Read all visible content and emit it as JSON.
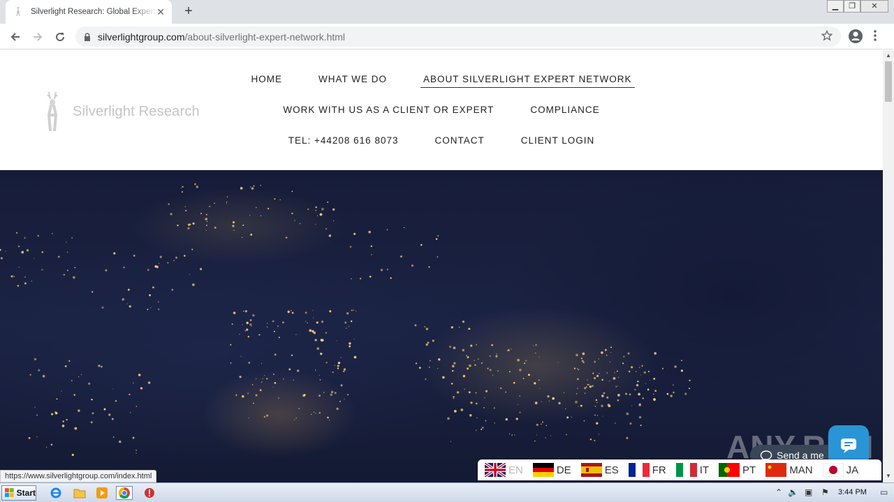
{
  "browser": {
    "tab_title": "Silverlight Research: Global Expert N",
    "tab_close": "✕",
    "new_tab": "+",
    "url_domain": "silverlightgroup.com",
    "url_path": "/about-silverlight-expert-network.html",
    "window_controls": [
      "▁",
      "❐",
      "✕"
    ]
  },
  "site": {
    "logo_text": "Silverlight Research",
    "nav": {
      "row1": [
        "HOME",
        "WHAT WE DO",
        "ABOUT SILVERLIGHT EXPERT NETWORK"
      ],
      "row2": [
        "WORK WITH US AS A CLIENT OR EXPERT",
        "COMPLIANCE"
      ],
      "row3": [
        "TEL: +44208 616 8073",
        "CONTACT",
        "CLIENT LOGIN"
      ],
      "active": "ABOUT SILVERLIGHT EXPERT NETWORK"
    },
    "languages": [
      "EN",
      "DE",
      "ES",
      "FR",
      "IT",
      "PT",
      "MAN",
      "JA"
    ],
    "chat_label": "Send a me",
    "watermark": "ANY.RUN",
    "status_url": "https://www.silverlightgroup.com/index.html"
  },
  "taskbar": {
    "start_label": "Start",
    "clock": "3:44 PM"
  },
  "colors": {
    "hero_dark": "#161c38",
    "chat_blue": "#2a95d6",
    "nav_text": "#222222"
  }
}
